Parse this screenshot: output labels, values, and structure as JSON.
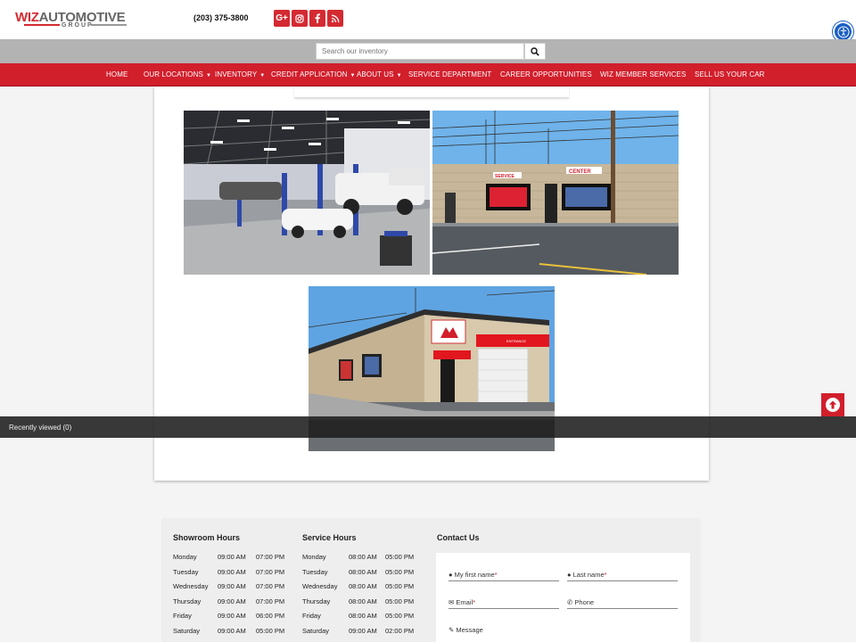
{
  "header": {
    "logo_brand": "WIZ",
    "logo_word": "AUTOMOTIVE",
    "logo_sub": "GROUP",
    "phone": "(203) 375-3800",
    "social": [
      "G+",
      "instagram-icon",
      "facebook-icon",
      "rss-icon"
    ]
  },
  "search": {
    "placeholder": "Search our inventory"
  },
  "nav": [
    {
      "label": "HOME",
      "caret": false
    },
    {
      "label": "OUR LOCATIONS",
      "caret": true
    },
    {
      "label": "INVENTORY",
      "caret": true
    },
    {
      "label": "CREDIT APPLICATION",
      "caret": true
    },
    {
      "label": "ABOUT US",
      "caret": true
    },
    {
      "label": "SERVICE DEPARTMENT",
      "caret": false
    },
    {
      "label": "CAREER OPPORTUNITIES",
      "caret": false
    },
    {
      "label": "WIZ MEMBER SERVICES",
      "caret": false
    },
    {
      "label": "SELL US YOUR CAR",
      "caret": false
    }
  ],
  "photos": {
    "sign_service": "SERVICE",
    "sign_center": "CENTER",
    "sign_entrance": "ENTRANCE"
  },
  "recently_viewed": "Recently viewed (0)",
  "footer": {
    "showroom_title": "Showroom Hours",
    "service_title": "Service Hours",
    "contact_title": "Contact Us",
    "showroom": [
      {
        "day": "Monday",
        "open": "09:00 AM",
        "close": "07:00 PM"
      },
      {
        "day": "Tuesday",
        "open": "09:00 AM",
        "close": "07:00 PM"
      },
      {
        "day": "Wednesday",
        "open": "09:00 AM",
        "close": "07:00 PM"
      },
      {
        "day": "Thursday",
        "open": "09:00 AM",
        "close": "07:00 PM"
      },
      {
        "day": "Friday",
        "open": "09:00 AM",
        "close": "06:00 PM"
      },
      {
        "day": "Saturday",
        "open": "09:00 AM",
        "close": "05:00 PM"
      }
    ],
    "service": [
      {
        "day": "Monday",
        "open": "08:00 AM",
        "close": "05:00 PM"
      },
      {
        "day": "Tuesday",
        "open": "08:00 AM",
        "close": "05:00 PM"
      },
      {
        "day": "Wednesday",
        "open": "08:00 AM",
        "close": "05:00 PM"
      },
      {
        "day": "Thursday",
        "open": "08:00 AM",
        "close": "05:00 PM"
      },
      {
        "day": "Friday",
        "open": "08:00 AM",
        "close": "05:00 PM"
      },
      {
        "day": "Saturday",
        "open": "09:00 AM",
        "close": "02:00 PM"
      }
    ],
    "contact": {
      "first_name": "My first name",
      "last_name": "Last name",
      "email": "Email",
      "phone": "Phone",
      "message": "Message",
      "required_mark": "*"
    }
  },
  "colors": {
    "brand_red": "#d21f2c",
    "accessibility_blue": "#1a5fc4"
  }
}
